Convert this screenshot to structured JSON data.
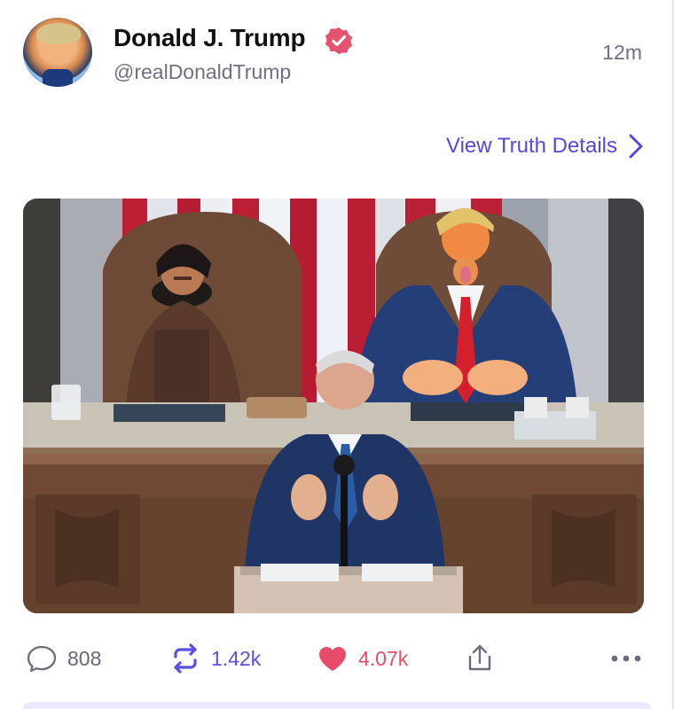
{
  "post": {
    "author_name": "Donald J. Trump",
    "author_handle": "@realDonaldTrump",
    "timestamp": "12m",
    "view_details_label": "View Truth Details",
    "counts": {
      "replies": "808",
      "retruths": "1.42k",
      "likes": "4.07k"
    }
  },
  "icons": {
    "verified": "verified-badge-icon",
    "chevron": "chevron-right-icon",
    "reply": "reply-bubble-icon",
    "retruth": "retruth-repeat-icon",
    "like": "heart-icon",
    "share": "share-icon",
    "more": "more-dots-icon"
  },
  "colors": {
    "accent": "#5848d8",
    "like": "#e64b6a",
    "verified": "#e4546f"
  }
}
